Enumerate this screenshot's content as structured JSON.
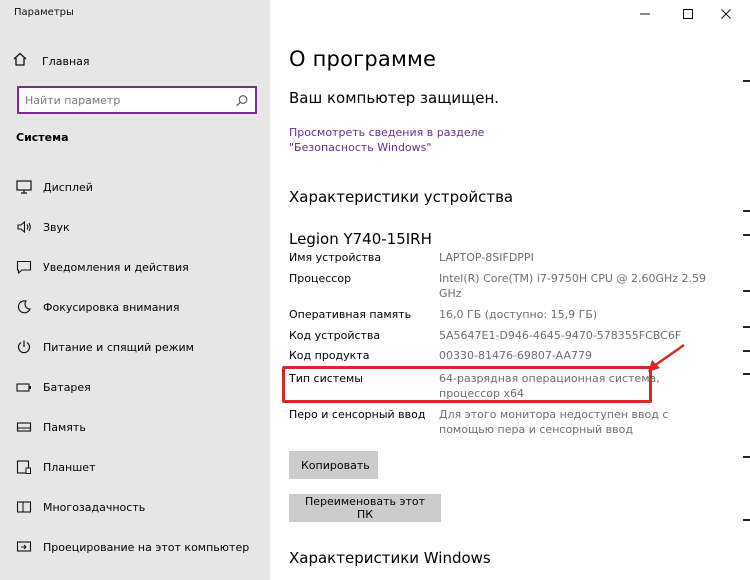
{
  "window": {
    "title": "Параметры",
    "minimize": "—",
    "maximize": "☐",
    "close": "✕"
  },
  "sidebar": {
    "home_label": "Главная",
    "search_placeholder": "Найти параметр",
    "section_title": "Система",
    "items": [
      {
        "label": "Дисплей",
        "icon": "display-icon"
      },
      {
        "label": "Звук",
        "icon": "sound-icon"
      },
      {
        "label": "Уведомления и действия",
        "icon": "notifications-icon"
      },
      {
        "label": "Фокусировка внимания",
        "icon": "focus-assist-icon"
      },
      {
        "label": "Питание и спящий режим",
        "icon": "power-icon"
      },
      {
        "label": "Батарея",
        "icon": "battery-icon"
      },
      {
        "label": "Память",
        "icon": "storage-icon"
      },
      {
        "label": "Планшет",
        "icon": "tablet-icon"
      },
      {
        "label": "Многозадачность",
        "icon": "multitasking-icon"
      },
      {
        "label": "Проецирование на этот компьютер",
        "icon": "projecting-icon"
      }
    ]
  },
  "main": {
    "title": "О программе",
    "protection_status": "Ваш компьютер защищен.",
    "security_link": "Просмотреть сведения в разделе \"Безопасность Windows\"",
    "device_specs_title": "Характеристики устройства",
    "device_name": "Legion Y740-15IRH",
    "specs": [
      {
        "label": "Имя устройства",
        "value": "LAPTOP-8SIFDPPI"
      },
      {
        "label": "Процессор",
        "value": "Intel(R) Core(TM) i7-9750H CPU @ 2.60GHz 2.59 GHz"
      },
      {
        "label": "Оперативная память",
        "value": "16,0 ГБ (доступно: 15,9 ГБ)"
      },
      {
        "label": "Код устройства",
        "value": "5A5647E1-D946-4645-9470-578355FCBC6F"
      },
      {
        "label": "Код продукта",
        "value": "00330-81476-69807-AA779"
      },
      {
        "label": "Тип системы",
        "value": "64-разрядная операционная система, процессор x64"
      },
      {
        "label": "Перо и сенсорный ввод",
        "value": "Для этого монитора недоступен ввод с помощью пера и сенсорный ввод"
      }
    ],
    "copy_button": "Копировать",
    "rename_button": "Переименовать этот ПК",
    "windows_specs_title": "Характеристики Windows"
  },
  "annotation": {
    "highlight_color": "#d32a2a"
  },
  "colors": {
    "sidebar_bg": "#e6e6e6",
    "accent_purple": "#7a2b8f",
    "link_purple": "#6b2d8a",
    "button_gray": "#cccccc"
  }
}
